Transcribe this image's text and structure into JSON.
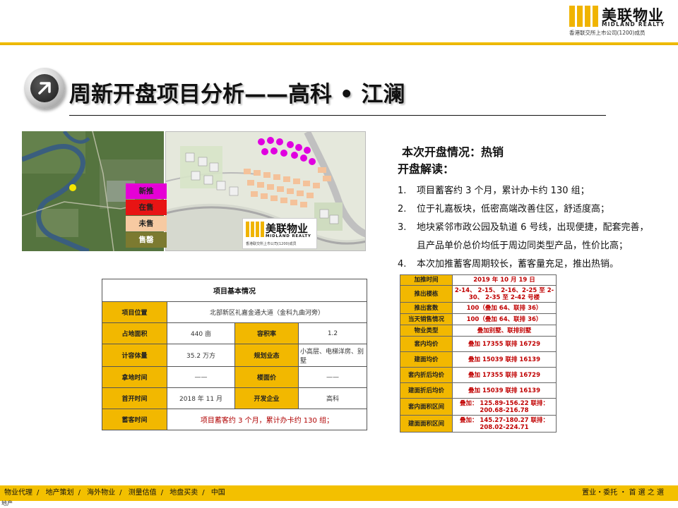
{
  "header": {
    "logo_cn": "美联物业",
    "logo_en": "MIDLAND REALTY",
    "logo_sub": "香港联交所上市公司(1200)成员"
  },
  "title": "周新开盘项目分析——高科 • 江澜",
  "legend": [
    {
      "label": "新推",
      "color": "#e600d6"
    },
    {
      "label": "在售",
      "color": "#e81414"
    },
    {
      "label": "未售",
      "color": "#f7caa2"
    },
    {
      "label": "售罄",
      "color": "#7c7a30"
    }
  ],
  "mini_logo": {
    "cn": "美联物业",
    "en": "MIDLAND REALTY",
    "sub": "香港联交所上市公司(1200)成员"
  },
  "info": {
    "heading1": "本次开盘情况：热销",
    "heading2": "开盘解读：",
    "items": [
      {
        "num": "1.",
        "text": "项目蓄客约 3 个月，累计办卡约 130 组；"
      },
      {
        "num": "2.",
        "text": "位于礼嘉板块，低密高端改善住区，舒适度高；"
      },
      {
        "num": "3.",
        "text": "地块紧邻市政公园及轨道 6 号线，出现便捷，配套完善，"
      },
      {
        "num": "",
        "text": "且产品单价总价均低于周边同类型产品，性价比高；"
      },
      {
        "num": "4.",
        "text": "本次加推蓄客周期较长，蓄客量充足，推出热销。"
      }
    ]
  },
  "basic_table": {
    "header": "项目基本情况",
    "location_label": "项目位置",
    "location_value": "北部新区礼嘉金通大道（金科九曲河旁）",
    "area_label": "占地面积",
    "area_value": "440 亩",
    "far_label": "容积率",
    "far_value": "1.2",
    "gfa_label": "计容体量",
    "gfa_value": "35.2 万方",
    "plan_label": "规划业态",
    "plan_value": "小高层、电梯洋房、别墅",
    "land_time_label": "拿地时间",
    "land_time_value": "——",
    "floor_price_label": "楼面价",
    "floor_price_value": "——",
    "open_time_label": "首开时间",
    "open_time_value": "2018 年 11 月",
    "developer_label": "开发企业",
    "developer_value": "高科",
    "reserve_label": "蓄客时间",
    "reserve_value": "项目蓄客约 3 个月，累计办卡约 130 组；"
  },
  "sales_table": {
    "rows": [
      {
        "label": "加推时间",
        "value": "2019 年 10 月 19 日"
      },
      {
        "label": "推出楼栋",
        "value": "2-14、 2-15、 2-16、2-25 至 2-30、 2-35 至 2-42 号楼"
      },
      {
        "label": "推出套数",
        "value": "100（叠加 64、联排 36）"
      },
      {
        "label": "当天销售情况",
        "value": "100（叠加 64、联排 36）"
      },
      {
        "label": "物业类型",
        "value": "叠加别墅、联排别墅"
      },
      {
        "label": "套内均价",
        "value": "叠加 17355 联排 16729"
      },
      {
        "label": "建面均价",
        "value": "叠加 15039 联排 16139"
      },
      {
        "label": "套内折后均价",
        "value": "叠加 17355 联排 16729"
      },
      {
        "label": "建面折后均价",
        "value": "叠加 15039 联排 16139"
      },
      {
        "label": "套内面积区间",
        "value": "叠加： 125.89-156.22 联排： 200.68-216.78"
      },
      {
        "label": "建面面积区间",
        "value": "叠加： 145.27-180.27 联排： 208.02-224.71"
      }
    ]
  },
  "footer": {
    "left": [
      "物业代理",
      "地产策划",
      "海外物业",
      "测量估值",
      "地盘买卖",
      "中国"
    ],
    "right": "置业・委托 ・ 首 選 之 選",
    "note": "地产"
  },
  "colors": {
    "accent": "#f3c000",
    "label_bg": "#f2b800",
    "sales_value": "#c00000"
  },
  "icons": [
    "arrow-up-right-icon",
    "logo-bars-icon"
  ]
}
